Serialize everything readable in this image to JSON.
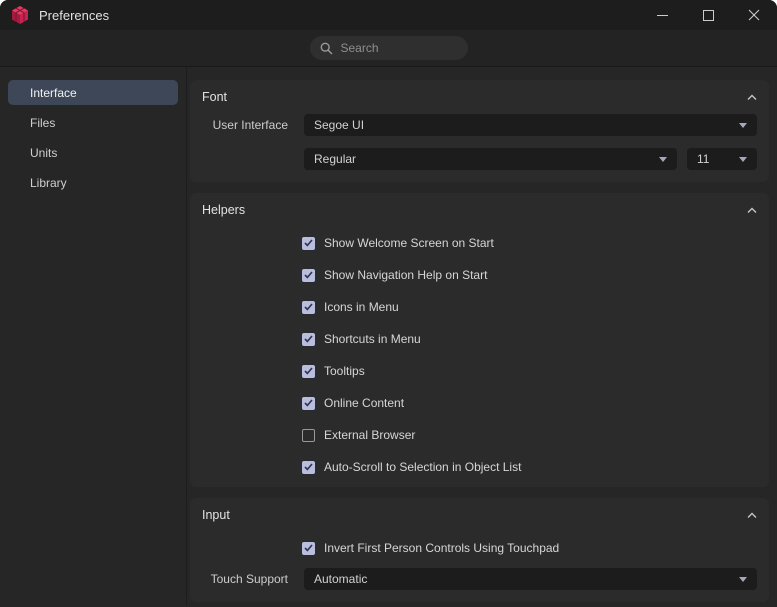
{
  "window": {
    "title": "Preferences"
  },
  "search": {
    "placeholder": "Search"
  },
  "sidebar": {
    "items": [
      {
        "label": "Interface",
        "selected": true
      },
      {
        "label": "Files",
        "selected": false
      },
      {
        "label": "Units",
        "selected": false
      },
      {
        "label": "Library",
        "selected": false
      }
    ]
  },
  "sections": {
    "font": {
      "title": "Font",
      "user_interface": {
        "label": "User Interface",
        "value": "Segoe UI"
      },
      "style": {
        "value": "Regular"
      },
      "size": {
        "value": "11"
      }
    },
    "helpers": {
      "title": "Helpers",
      "items": [
        {
          "label": "Show Welcome Screen on Start",
          "checked": true
        },
        {
          "label": "Show Navigation Help on Start",
          "checked": true
        },
        {
          "label": "Icons in Menu",
          "checked": true
        },
        {
          "label": "Shortcuts in Menu",
          "checked": true
        },
        {
          "label": "Tooltips",
          "checked": true
        },
        {
          "label": "Online Content",
          "checked": true
        },
        {
          "label": "External Browser",
          "checked": false
        },
        {
          "label": "Auto-Scroll to Selection in Object List",
          "checked": true
        }
      ]
    },
    "input": {
      "title": "Input",
      "items": [
        {
          "label": "Invert First Person Controls Using Touchpad",
          "checked": true
        }
      ],
      "touch_support": {
        "label": "Touch Support",
        "value": "Automatic"
      }
    }
  },
  "colors": {
    "app_logo": "#d62a52",
    "sidebar_selected": "#3d4757",
    "checkbox_checked": "#b9bddf",
    "panel_bg": "#2b2b2b",
    "window_bg": "#262626"
  }
}
